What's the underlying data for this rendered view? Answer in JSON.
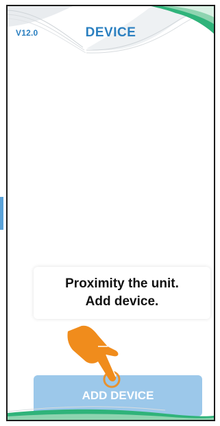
{
  "app": {
    "version": "V12.0",
    "title": "DEVICE"
  },
  "tooltip": {
    "line1": "Proximity the unit.",
    "line2": "Add device."
  },
  "actions": {
    "add_device_label": "ADD DEVICE"
  },
  "icons": {
    "pointer": "pointing-hand-icon"
  },
  "colors": {
    "accent": "#2a7fc0",
    "button_bg": "#9cc8ea",
    "hand": "#f08c1c",
    "wave_green": "#2fb37a"
  }
}
